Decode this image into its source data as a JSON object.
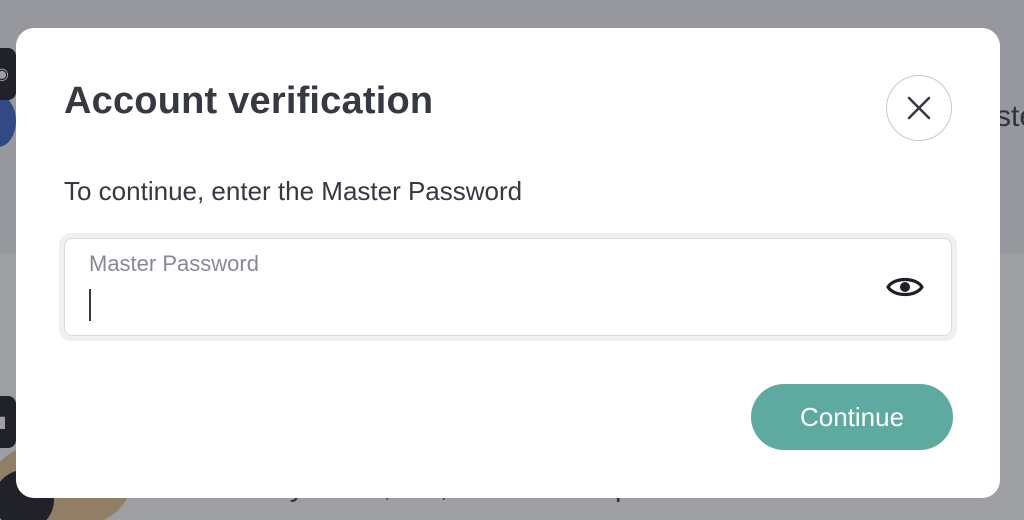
{
  "background": {
    "right_snippet": "ste",
    "bottom_snippet": "Identify weak, old, and reused passwords"
  },
  "dialog": {
    "title": "Account verification",
    "description": "To continue, enter the Master Password",
    "password_field": {
      "label": "Master Password",
      "value": ""
    },
    "continue_label": "Continue",
    "icons": {
      "close": "close-icon",
      "show_password": "eye-icon"
    },
    "colors": {
      "primary_button": "#5ea9a0",
      "title_text": "#363842"
    }
  }
}
